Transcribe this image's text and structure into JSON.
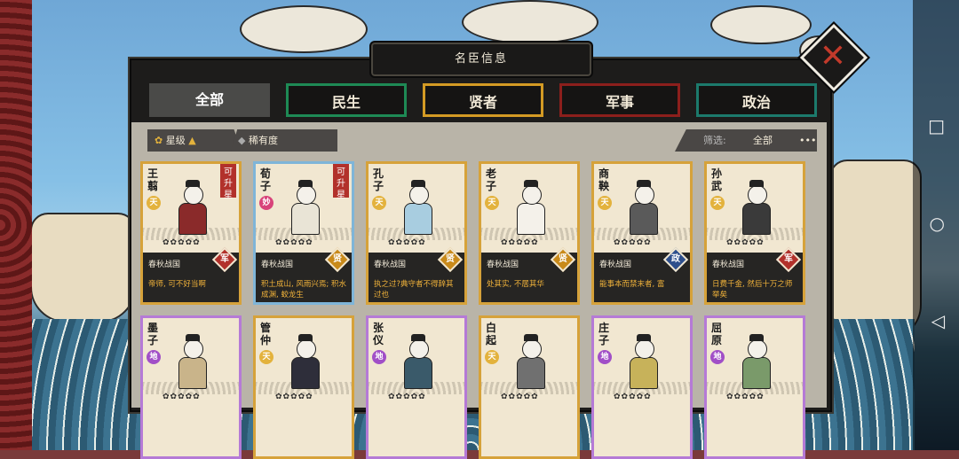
{
  "panel": {
    "title": "名臣信息"
  },
  "tabs": [
    {
      "label": "全部",
      "style": "active"
    },
    {
      "label": "民生",
      "style": "green"
    },
    {
      "label": "贤者",
      "style": "gold"
    },
    {
      "label": "军事",
      "style": "red"
    },
    {
      "label": "政治",
      "style": "teal"
    }
  ],
  "sort": {
    "star_label": "星级",
    "rarity_label": "稀有度"
  },
  "filter": {
    "label": "筛选:",
    "value": "全部",
    "more": "•••"
  },
  "cards": [
    {
      "name": "王翦",
      "grade": "天",
      "grade_type": "tian",
      "upgrade": "可升星",
      "state": "春秋战国",
      "role": "军",
      "role_type": "jun",
      "desc": "帝师, 可不好当啊",
      "border": "gold",
      "stars": "✿✿✿✿✿",
      "robe": "#8a2a2a"
    },
    {
      "name": "荀子",
      "grade": "妙",
      "grade_type": "miao",
      "upgrade": "可升星",
      "state": "春秋战国",
      "role": "贤",
      "role_type": "xian",
      "desc": "积土成山, 风雨兴焉; 积水成渊, 蛟龙生",
      "border": "blue",
      "stars": "✿✿✿✿✿",
      "robe": "#e9e4d6"
    },
    {
      "name": "孔子",
      "grade": "天",
      "grade_type": "tian",
      "upgrade": "",
      "state": "春秋战国",
      "role": "贤",
      "role_type": "xian",
      "desc": "执之过?典守者不得辞其过也",
      "border": "gold",
      "stars": "✿✿✿✿✿",
      "robe": "#a8cde0"
    },
    {
      "name": "老子",
      "grade": "天",
      "grade_type": "tian",
      "upgrade": "",
      "state": "春秋战国",
      "role": "贤",
      "role_type": "xian",
      "desc": "处其实, 不居其华",
      "border": "gold",
      "stars": "✿✿✿✿✿",
      "robe": "#f4f1ea"
    },
    {
      "name": "商鞅",
      "grade": "天",
      "grade_type": "tian",
      "upgrade": "",
      "state": "春秋战国",
      "role": "政",
      "role_type": "zheng",
      "desc": "能事本而禁末者, 富",
      "border": "gold",
      "stars": "✿✿✿✿✿",
      "robe": "#5a5a5a"
    },
    {
      "name": "孙武",
      "grade": "天",
      "grade_type": "tian",
      "upgrade": "",
      "state": "春秋战国",
      "role": "军",
      "role_type": "jun",
      "desc": "日费千金, 然后十万之师举矣",
      "border": "gold",
      "stars": "✿✿✿✿✿",
      "robe": "#3a3a3a"
    },
    {
      "name": "墨子",
      "grade": "地",
      "grade_type": "di",
      "upgrade": "",
      "state": "",
      "role": "",
      "role_type": "",
      "desc": "",
      "border": "purple",
      "stars": "✿✿✿✿✿",
      "robe": "#c9b48a"
    },
    {
      "name": "管仲",
      "grade": "天",
      "grade_type": "tian",
      "upgrade": "",
      "state": "",
      "role": "",
      "role_type": "",
      "desc": "",
      "border": "gold",
      "stars": "✿✿✿✿✿",
      "robe": "#2e2e3a"
    },
    {
      "name": "张仪",
      "grade": "地",
      "grade_type": "di",
      "upgrade": "",
      "state": "",
      "role": "",
      "role_type": "",
      "desc": "",
      "border": "purple",
      "stars": "✿✿✿✿✿",
      "robe": "#3a5a6a"
    },
    {
      "name": "白起",
      "grade": "天",
      "grade_type": "tian",
      "upgrade": "",
      "state": "",
      "role": "",
      "role_type": "",
      "desc": "",
      "border": "gold",
      "stars": "✿✿✿✿✿",
      "robe": "#707070"
    },
    {
      "name": "庄子",
      "grade": "地",
      "grade_type": "di",
      "upgrade": "",
      "state": "",
      "role": "",
      "role_type": "",
      "desc": "",
      "border": "purple",
      "stars": "✿✿✿✿✿",
      "robe": "#c7b25a"
    },
    {
      "name": "屈原",
      "grade": "地",
      "grade_type": "di",
      "upgrade": "",
      "state": "",
      "role": "",
      "role_type": "",
      "desc": "",
      "border": "purple",
      "stars": "✿✿✿✿✿",
      "robe": "#7a9a6a"
    }
  ],
  "system_nav": {
    "recents": "□",
    "home": "○",
    "back": "◁"
  }
}
